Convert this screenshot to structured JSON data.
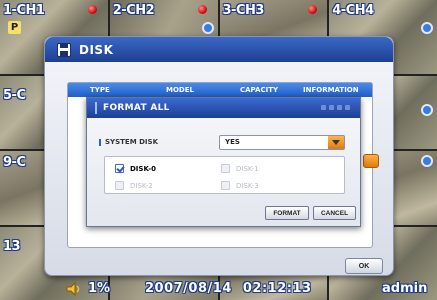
{
  "cameras": [
    "1-CH1",
    "2-CH2",
    "3-CH3",
    "4-CH4",
    "5-C",
    "9-C",
    "13"
  ],
  "overlay_badge": "P",
  "status": {
    "volume": "1%",
    "date": "2007/08/14",
    "time": "02:12:13",
    "user": "admin"
  },
  "disk_window": {
    "title": "DISK",
    "columns": [
      "TYPE",
      "MODEL",
      "CAPACITY",
      "INFORMATION"
    ],
    "ok_label": "OK"
  },
  "format_dialog": {
    "title": "FORMAT ALL",
    "system_disk_label": "SYSTEM DISK",
    "system_disk_value": "YES",
    "disks": [
      {
        "label": "DISK-0",
        "checked": true,
        "enabled": true
      },
      {
        "label": "DISK-1",
        "checked": false,
        "enabled": false
      },
      {
        "label": "DISK-2",
        "checked": false,
        "enabled": false
      },
      {
        "label": "DISK-3",
        "checked": false,
        "enabled": false
      }
    ],
    "format_label": "FORMAT",
    "cancel_label": "CANCEL"
  },
  "colors": {
    "title_bar": "#1d3f92",
    "header_blue": "#1f5fc8",
    "accent_orange": "#e07a10",
    "rec_red": "#d01010"
  }
}
